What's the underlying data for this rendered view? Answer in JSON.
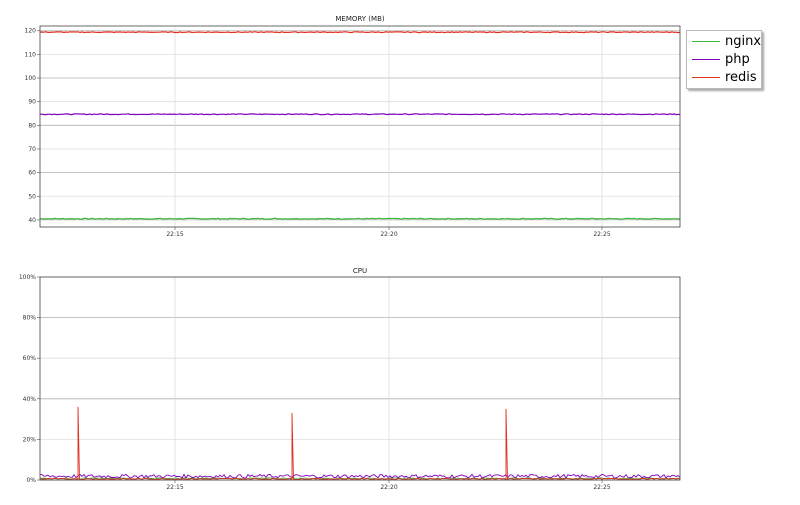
{
  "chart_data": [
    {
      "type": "line",
      "title": "MEMORY (MB)",
      "x_ticks": [
        "22:15",
        "22:20",
        "22:25"
      ],
      "y_ticks": [
        "40",
        "50",
        "60",
        "70",
        "80",
        "90",
        "100",
        "110",
        "120"
      ],
      "ylim": [
        37,
        122
      ],
      "grid": true,
      "legend_position": "top-right",
      "series": [
        {
          "name": "nginx",
          "color": "#3cb83c",
          "level": 40.5
        },
        {
          "name": "php",
          "color": "#8000c0",
          "level": 84.7
        },
        {
          "name": "redis",
          "color": "#e03020",
          "level": 119.4
        }
      ]
    },
    {
      "type": "line",
      "title": "CPU",
      "x_ticks": [
        "22:15",
        "22:20",
        "22:25"
      ],
      "y_ticks": [
        "0%",
        "20%",
        "40%",
        "60%",
        "80%",
        "100%"
      ],
      "ylim": [
        0,
        100
      ],
      "grid": true,
      "series": [
        {
          "name": "nginx",
          "color": "#3cb83c",
          "level": 0.5
        },
        {
          "name": "php",
          "color": "#8000c0",
          "level": 1.5
        },
        {
          "name": "redis",
          "color": "#e03020",
          "level": 0.3,
          "spikes": [
            36,
            33,
            35
          ]
        }
      ]
    }
  ],
  "legend": [
    {
      "label": "nginx",
      "color": "#3cb83c"
    },
    {
      "label": "php",
      "color": "#8000c0"
    },
    {
      "label": "redis",
      "color": "#e03020"
    }
  ]
}
